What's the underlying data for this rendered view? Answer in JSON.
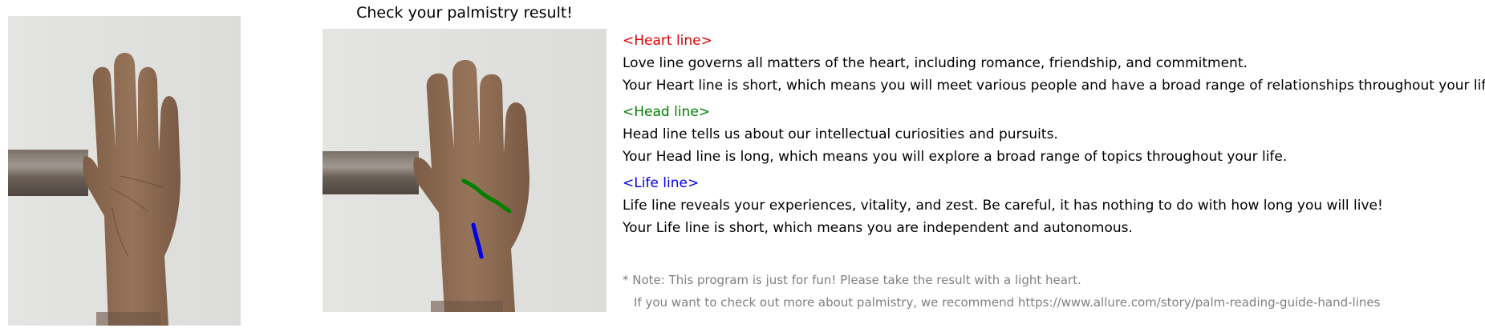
{
  "title": "Check your palmistry result!",
  "photos": {
    "original": "palm-photo",
    "annotated": "palm-photo-with-lines"
  },
  "colors": {
    "heart": "#e00000",
    "head": "#008000",
    "life": "#0000e6",
    "note": "#808080"
  },
  "sections": [
    {
      "heading": "<Heart line>",
      "description": "Love line governs all matters of the heart, including romance, friendship, and commitment.",
      "result": "Your Heart line is short, which means you will meet various people and have a broad range of relationships throughout your life."
    },
    {
      "heading": "<Head line>",
      "description": "Head line tells us about our intellectual curiosities and pursuits.",
      "result": "Your Head line is long, which means you will explore a broad range of topics throughout your life."
    },
    {
      "heading": "<Life line>",
      "description": "Life line reveals your experiences, vitality, and zest. Be careful, it has nothing to do with how long you will live!",
      "result": "Your Life line is short, which means you are independent and autonomous."
    }
  ],
  "note": {
    "line1": "* Note: This program is just for fun! Please take the result with a light heart.",
    "line2": "If you want to check out more about palmistry, we recommend https://www.allure.com/story/palm-reading-guide-hand-lines"
  }
}
